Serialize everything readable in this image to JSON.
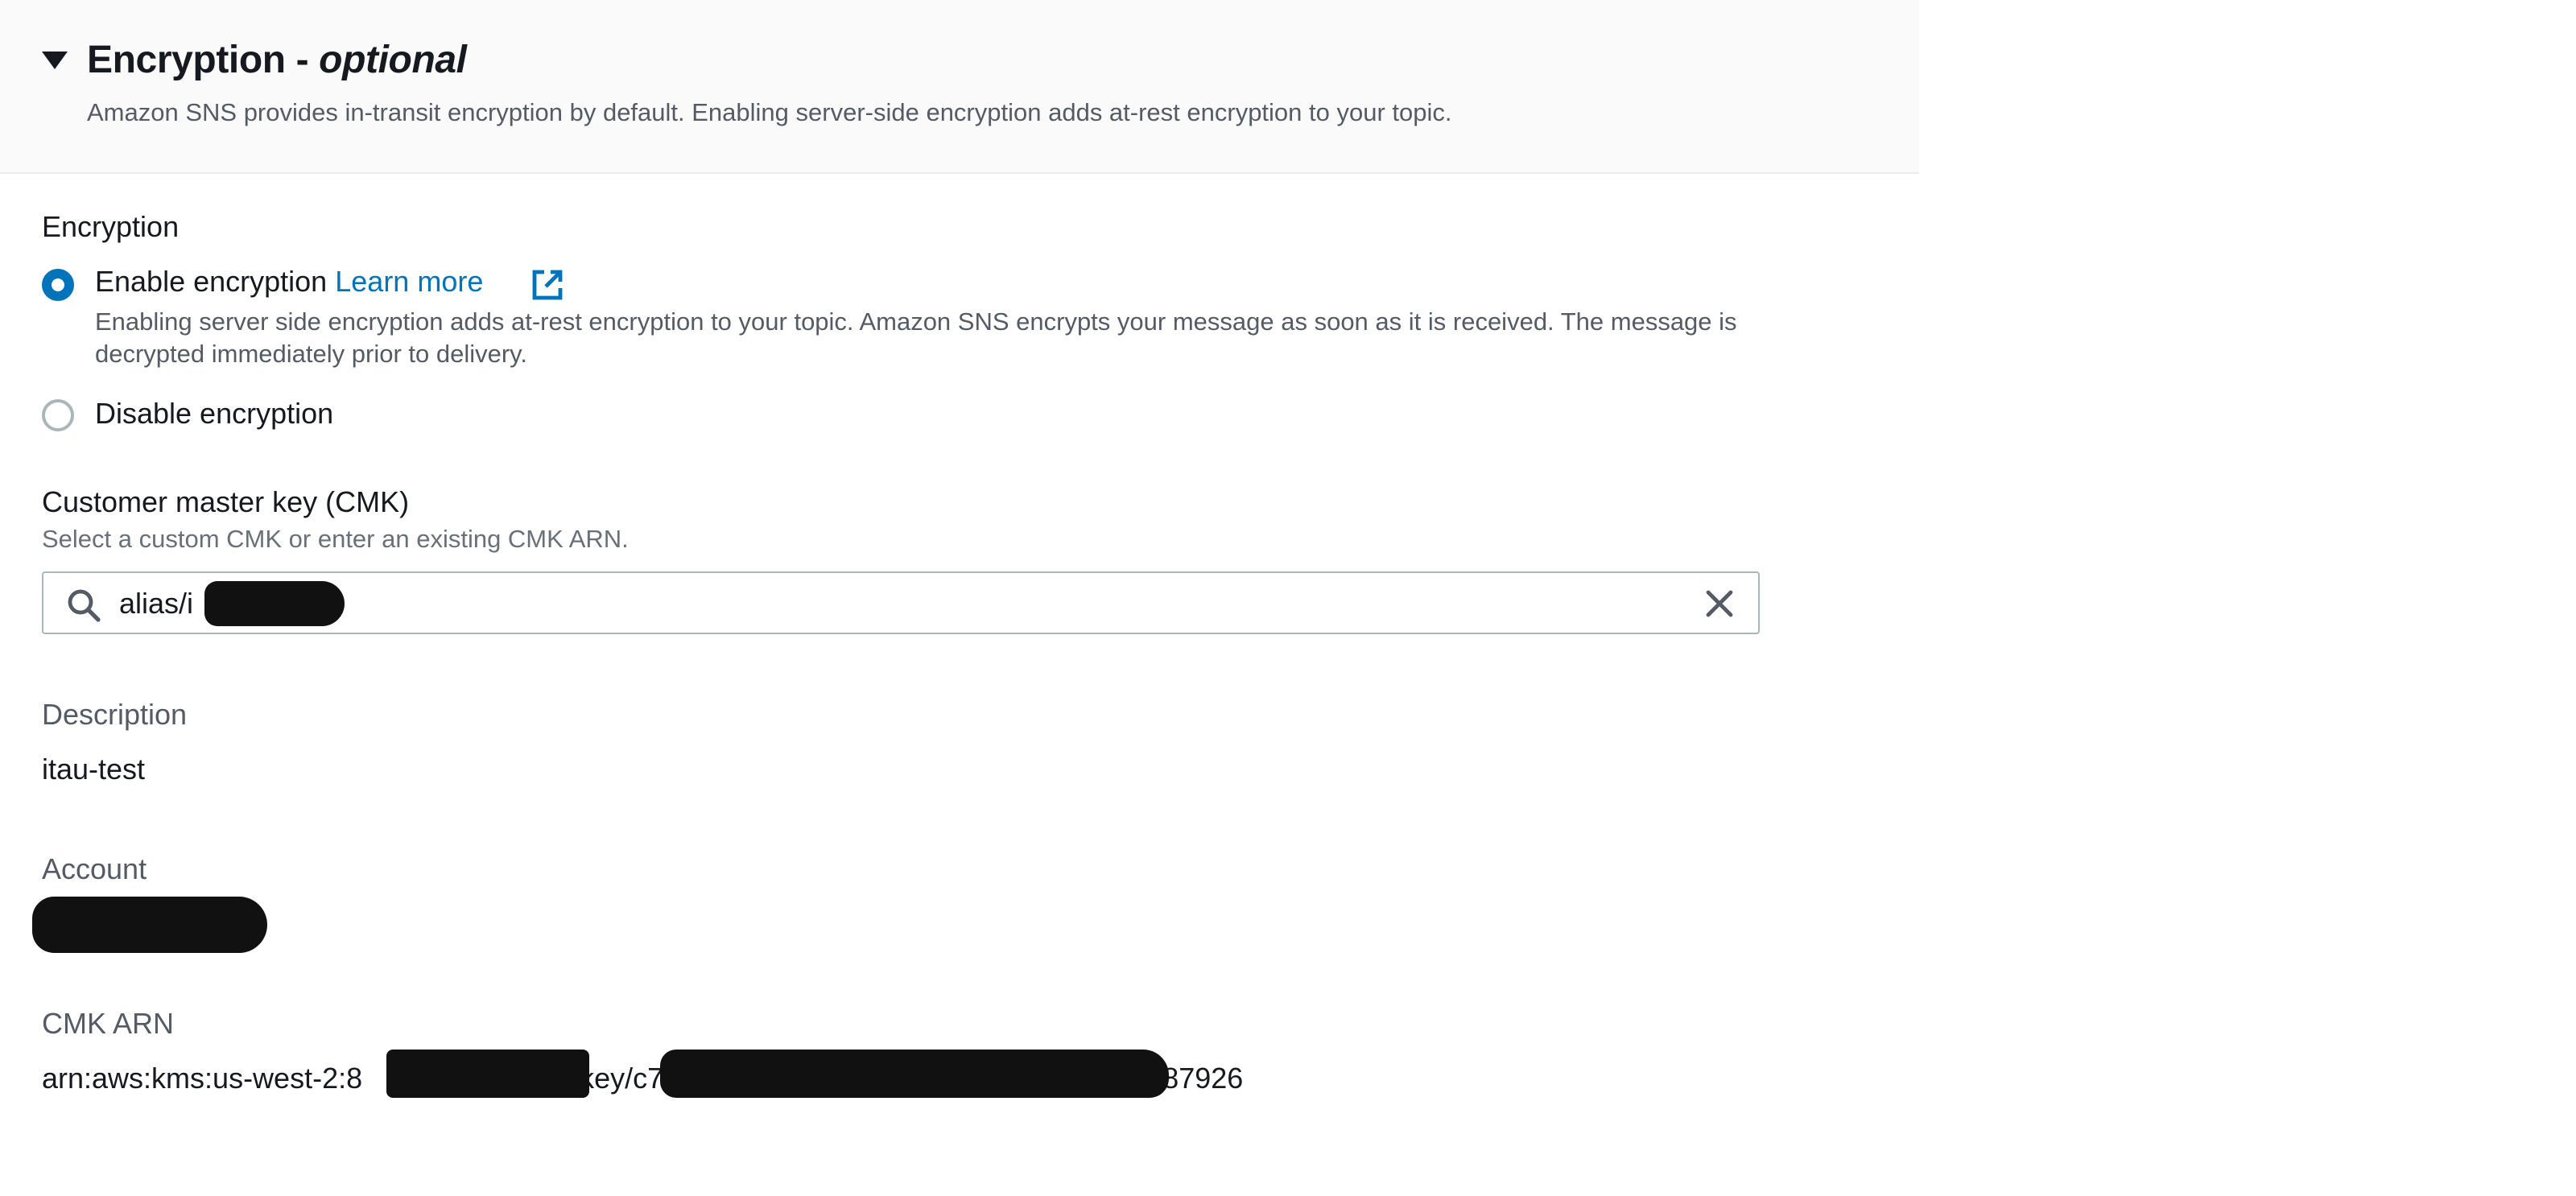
{
  "header": {
    "title_main": "Encryption - ",
    "title_optional": "optional",
    "description": "Amazon SNS provides in-transit encryption by default. Enabling server-side encryption adds at-rest encryption to your topic."
  },
  "encryption": {
    "label": "Encryption",
    "enable": {
      "label": "Enable encryption",
      "link": "Learn more",
      "checked": true,
      "description": "Enabling server side encryption adds at-rest encryption to your topic. Amazon SNS encrypts your message as soon as it is received. The message is decrypted immediately prior to delivery."
    },
    "disable": {
      "label": "Disable encryption",
      "checked": false
    }
  },
  "cmk": {
    "label": "Customer master key (CMK)",
    "hint": "Select a custom CMK or enter an existing CMK ARN.",
    "value": "alias/i"
  },
  "details": {
    "description_label": "Description",
    "description_value": "itau-test",
    "account_label": "Account",
    "arn_label": "CMK ARN",
    "arn_prefix": "arn:aws:kms:us-west-2:8",
    "arn_middle": ":key/c7",
    "arn_suffix": "87926"
  },
  "icons": {
    "caret": "caret-down-icon",
    "external": "external-link-icon",
    "search": "search-icon",
    "clear": "close-icon"
  },
  "colors": {
    "accent": "#0073bb",
    "text": "#16191f",
    "muted": "#545b64",
    "header_bg": "#fafafa"
  }
}
